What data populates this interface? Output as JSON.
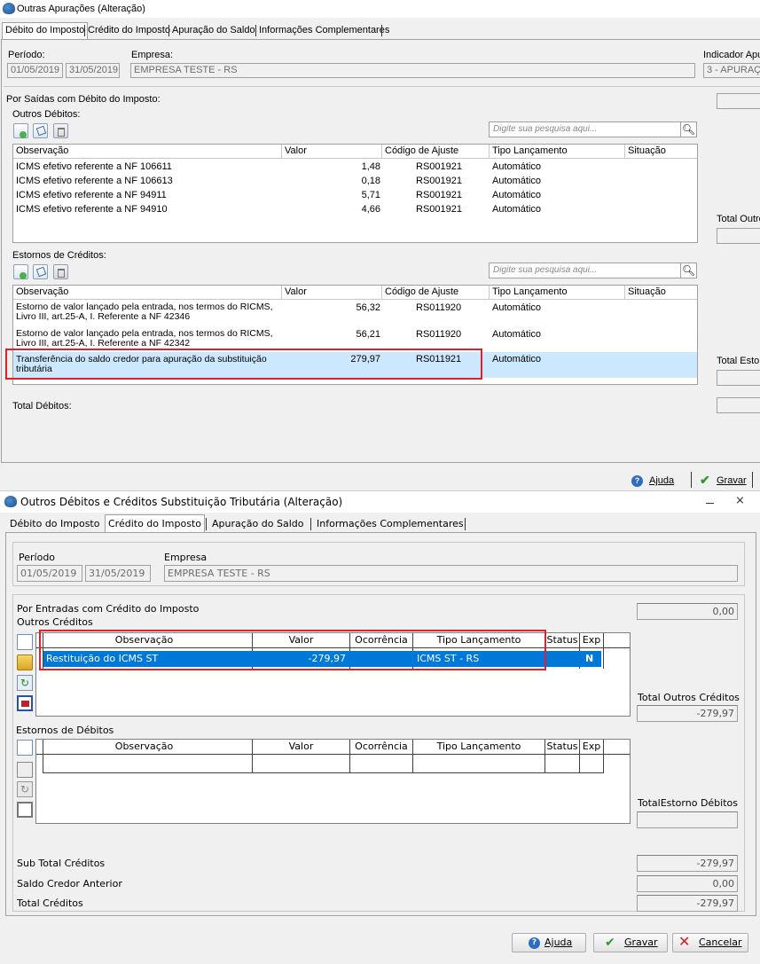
{
  "win1": {
    "title": "Outras Apurações (Alteração)",
    "tabs": [
      "Débito do Imposto",
      "Crédito do Imposto",
      "Apuração do Saldo",
      "Informações Complementares"
    ],
    "periodo_label": "Período:",
    "periodo_de": "01/05/2019",
    "periodo_ate": "31/05/2019",
    "empresa_label": "Empresa:",
    "empresa": "EMPRESA TESTE - RS",
    "indicador_label": "Indicador Apu",
    "indicador": "3 - APURAÇ",
    "saidas_label": "Por Saídas com Débito do Imposto:",
    "outros_debitos_label": "Outros Débitos:",
    "search_placeholder": "Digite sua pesquisa aqui...",
    "columns": [
      "Observação",
      "Valor",
      "Código de Ajuste",
      "Tipo Lançamento",
      "Situação"
    ],
    "outros_debitos": [
      {
        "obs": "ICMS efetivo referente a NF 106611",
        "valor": "1,48",
        "codigo": "RS001921",
        "tipo": "Automático"
      },
      {
        "obs": "ICMS efetivo referente a NF 106613",
        "valor": "0,18",
        "codigo": "RS001921",
        "tipo": "Automático"
      },
      {
        "obs": "ICMS efetivo referente a NF 94911",
        "valor": "5,71",
        "codigo": "RS001921",
        "tipo": "Automático"
      },
      {
        "obs": "ICMS efetivo referente a NF 94910",
        "valor": "4,66",
        "codigo": "RS001921",
        "tipo": "Automático"
      }
    ],
    "total_outros_label": "Total Outro",
    "estornos_label": "Estornos de Créditos:",
    "estornos": [
      {
        "obs1": "Estorno de valor lançado pela entrada, nos termos do RICMS,",
        "obs2": "Livro III, art.25-A, I. Referente a NF 42346",
        "valor": "56,32",
        "codigo": "RS011920",
        "tipo": "Automático"
      },
      {
        "obs1": "Estorno de valor lançado pela entrada, nos termos do RICMS,",
        "obs2": "Livro III, art.25-A, I. Referente a NF 42342",
        "valor": "56,21",
        "codigo": "RS011920",
        "tipo": "Automático"
      },
      {
        "obs1": "Transferência do saldo credor  para apuração da substituição",
        "obs2": "tributária",
        "valor": "279,97",
        "codigo": "RS011921",
        "tipo": "Automático"
      }
    ],
    "total_estor_label": "Total Estor",
    "total_debitos_label": "Total Débitos:",
    "ajuda": "Ajuda",
    "gravar": "Gravar"
  },
  "win2": {
    "title": "Outros Débitos e Créditos Substituição Tributária (Alteração)",
    "tabs": [
      "Débito do Imposto",
      "Crédito do Imposto",
      "Apuração do Saldo",
      "Informações Complementares"
    ],
    "periodo_label": "Período",
    "periodo_de": "01/05/2019",
    "periodo_ate": "31/05/2019",
    "empresa_label": "Empresa",
    "empresa": "EMPRESA TESTE - RS",
    "entradas_label": "Por Entradas com Crédito do Imposto",
    "outros_creditos_label": "Outros Créditos",
    "columns": [
      "Observação",
      "Valor",
      "Ocorrência",
      "Tipo Lançamento",
      "Status",
      "Exp"
    ],
    "outros_creditos": [
      {
        "obs": "Restituição do ICMS ST",
        "valor": "-279,97",
        "ocorrencia": "",
        "tipo": "ICMS ST - RS",
        "status": "",
        "exp": "N"
      }
    ],
    "top_value": "0,00",
    "total_outros_creditos_label": "Total Outros Créditos",
    "total_outros_creditos": "-279,97",
    "estornos_debitos_label": "Estornos de Débitos",
    "total_estorno_label": "TotalEstorno Débitos",
    "total_estorno": "",
    "sub_total_label": "Sub Total Créditos",
    "sub_total": "-279,97",
    "saldo_credor_label": "Saldo Credor Anterior",
    "saldo_credor": "0,00",
    "total_creditos_label": "Total Créditos",
    "total_creditos": "-279,97",
    "ajuda": "Ajuda",
    "gravar": "Gravar",
    "cancelar": "Cancelar"
  },
  "colors": {
    "highlight": "#cce8ff",
    "selected_row": "#0078d7",
    "red_box": "#e0202a"
  }
}
